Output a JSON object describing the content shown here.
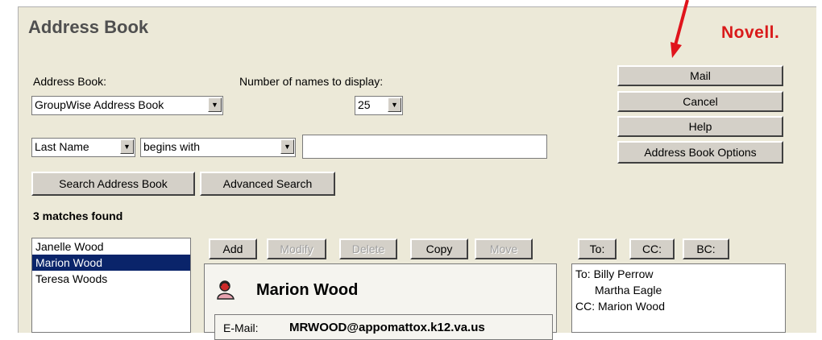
{
  "window": {
    "title": "Address Book",
    "brand": "Novell."
  },
  "form": {
    "address_book_label": "Address Book:",
    "address_book_value": "GroupWise Address Book",
    "names_label": "Number of names to display:",
    "names_value": "25",
    "field_value": "Last Name",
    "condition_value": "begins with",
    "search_text": ""
  },
  "buttons": {
    "mail": "Mail",
    "cancel": "Cancel",
    "help": "Help",
    "options": "Address Book Options",
    "search": "Search Address Book",
    "advanced": "Advanced Search",
    "add": "Add",
    "modify": "Modify",
    "delete": "Delete",
    "copy": "Copy",
    "move": "Move",
    "to": "To:",
    "cc": "CC:",
    "bc": "BC:"
  },
  "results": {
    "count_text": "3 matches found",
    "items": [
      "Janelle Wood",
      "Marion Wood",
      "Teresa Woods"
    ],
    "selected": "Marion Wood"
  },
  "detail": {
    "name": "Marion Wood",
    "email_label": "E-Mail:",
    "email_value": "MRWOOD@appomattox.k12.va.us",
    "icon": "person-icon"
  },
  "recipients": {
    "lines": [
      "To: Billy Perrow",
      "Martha Eagle",
      "CC: Marion Wood"
    ]
  },
  "annotation": {
    "arrow_color": "#e0141c"
  }
}
